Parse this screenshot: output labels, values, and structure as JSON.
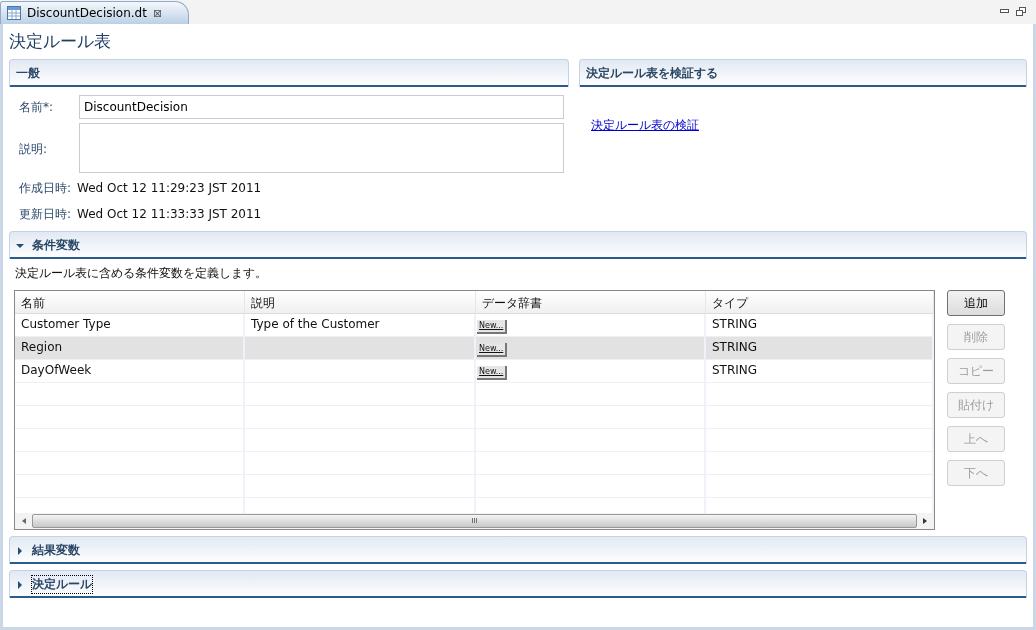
{
  "tab": {
    "title": "DiscountDecision.dt",
    "close": "⊠"
  },
  "page_title": "決定ルール表",
  "general": {
    "title": "一般",
    "fields": [
      {
        "label": "名前*:",
        "value": "DiscountDecision",
        "kind": "input"
      },
      {
        "label": "説明:",
        "kind": "textarea"
      },
      {
        "label": "作成日時:",
        "value": "Wed Oct 12 11:29:23 JST 2011",
        "kind": "text"
      },
      {
        "label": "更新日時:",
        "value": "Wed Oct 12 11:33:33 JST 2011",
        "kind": "text"
      }
    ]
  },
  "validate": {
    "title": "決定ルール表を検証する",
    "link": "決定ルール表の検証"
  },
  "sections": [
    {
      "title": "条件変数",
      "expanded": true,
      "focused": false,
      "description": "決定ルール表に含める条件変数を定義します。",
      "table": {
        "columns": [
          "名前",
          "説明",
          "データ辞書",
          "タイプ"
        ],
        "rows": [
          {
            "cells": [
              "Customer Type",
              "Type of the Customer",
              "New...",
              "STRING"
            ],
            "selected": false
          },
          {
            "cells": [
              "Region",
              null,
              "New...",
              "STRING"
            ],
            "selected": true
          },
          {
            "cells": [
              "DayOfWeek",
              null,
              "New...",
              "STRING"
            ],
            "selected": false
          }
        ],
        "scroll_arrow": "III"
      },
      "buttons": [
        {
          "label": "追加",
          "disabled": false
        },
        {
          "label": "削除",
          "disabled": true
        },
        {
          "label": "コピー",
          "disabled": true
        },
        {
          "label": "貼付け",
          "disabled": true
        },
        {
          "label": "上へ",
          "disabled": true
        },
        {
          "label": "下へ",
          "disabled": true
        }
      ]
    },
    {
      "title": "結果変数",
      "expanded": false,
      "focused": false
    },
    {
      "title": "決定ルール",
      "expanded": false,
      "focused": true
    }
  ]
}
